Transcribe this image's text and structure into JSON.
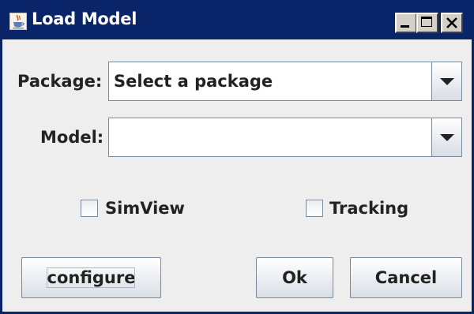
{
  "window": {
    "title": "Load Model",
    "icon": "java-cup-icon",
    "controls": [
      "minimize",
      "maximize",
      "close"
    ]
  },
  "form": {
    "package_label": "Package:",
    "package_value": "Select a package",
    "model_label": "Model:",
    "model_value": ""
  },
  "options": {
    "simview_label": "SimView",
    "simview_checked": false,
    "tracking_label": "Tracking",
    "tracking_checked": false
  },
  "buttons": {
    "configure": "configure",
    "ok": "Ok",
    "cancel": "Cancel"
  },
  "colors": {
    "titlebar": "#0a246a",
    "dialog_bg": "#eeeeee"
  }
}
